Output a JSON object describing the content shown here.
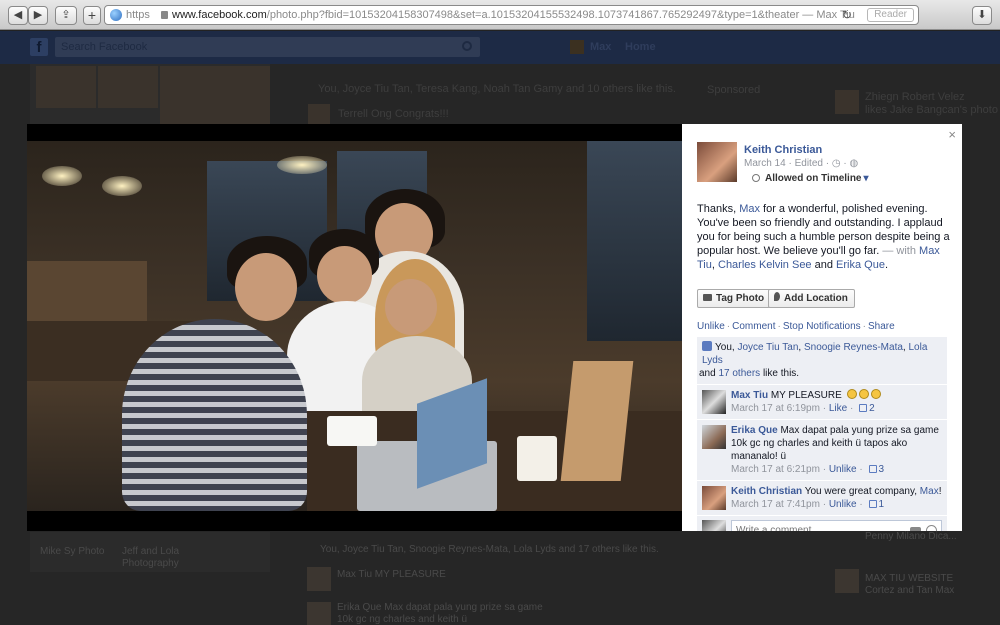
{
  "browser": {
    "back_label": "◀",
    "forward_label": "▶",
    "share_label": "⇪",
    "new_tab_label": "+",
    "url_scheme": "https",
    "url_domain": "www.facebook.com",
    "url_path": "/photo.php?fbid=10153204158307498&set=a.10153204155532498.1073741867.765292497&type=1&theater — Max Tiu",
    "reader_label": "Reader",
    "download_label": "⬇"
  },
  "fb_header": {
    "logo": "f",
    "search_placeholder": "Search Facebook",
    "user_name": "Max",
    "home_label": "Home"
  },
  "background": {
    "likes_line_top": "You, Joyce Tiu Tan, Teresa Kang, Noah Tan Gamy and 10 others like this.",
    "comment_top": "Terrell Ong Congrats!!!",
    "sponsored": "Sponsored",
    "ticker_1_name": "Zhiegn Robert Velez",
    "ticker_1_text": "likes Jake Bangcan's photo",
    "left_label_1": "Mike Sy Photo",
    "left_label_2": "Jeff and Lola Photography",
    "likes_line_bottom": "You, Joyce Tiu Tan, Snoogie Reynes-Mata, Lola Lyds and 17 others like this.",
    "bottom_comment_1": "Max Tiu MY PLEASURE",
    "bottom_comment_2_a": "Erika Que Max dapat pala yung prize sa game",
    "bottom_comment_2_b": "10k gc ng charles and keith ü",
    "right_label_1": "Penny Milano Dica...",
    "right_label_2": "MAX TIU WEBSITE",
    "right_label_3": "Cortez and Tan Max"
  },
  "post": {
    "close": "×",
    "author": "Keith Christian",
    "date": "March 14",
    "edited": "Edited",
    "privacy_sep": "·",
    "timeline_label": "Allowed on Timeline",
    "caption_1": "Thanks, ",
    "caption_link_max": "Max",
    "caption_2": " for a wonderful, polished evening. You've been so friendly and outstanding. I applaud you for being such a humble person despite being a popular host. We believe you'll go far. ",
    "caption_with": "— with ",
    "tag_1": "Max Tiu",
    "tag_sep_1": ", ",
    "tag_2": "Charles Kelvin See",
    "tag_and": " and ",
    "tag_3": "Erika Que",
    "tag_end": ".",
    "tag_photo_label": "Tag Photo",
    "add_location_label": "Add Location",
    "actions": {
      "unlike": "Unlike",
      "comment": "Comment",
      "stop_notifications": "Stop Notifications",
      "share": "Share",
      "sep": "·"
    },
    "likes": {
      "prefix": "You, ",
      "name_1": "Joyce Tiu Tan",
      "sep": ", ",
      "name_2": "Snoogie Reynes-Mata",
      "name_3": "Lola Lyds",
      "and": " and ",
      "others": "17 others",
      "suffix": " like this."
    },
    "comments": [
      {
        "name": "Max Tiu",
        "text": " MY PLEASURE",
        "time": "March 17 at 6:19pm",
        "action": "Like",
        "likes": "2"
      },
      {
        "name": "Erika Que",
        "text": " Max dapat pala yung prize sa game 10k gc ng charles and keith ü tapos ako mananalo! ü",
        "time": "March 17 at 6:21pm",
        "action": "Unlike",
        "likes": "3"
      },
      {
        "name": "Keith Christian",
        "text": " You were great company, ",
        "link": "Max",
        "tail": "!",
        "time": "March 17 at 7:41pm",
        "action": "Unlike",
        "likes": "1"
      }
    ],
    "write_placeholder": "Write a comment..."
  },
  "colors": {
    "fb_blue": "#3b5998",
    "meta_grey": "#90949c",
    "ufi_bg": "#edeff4"
  }
}
